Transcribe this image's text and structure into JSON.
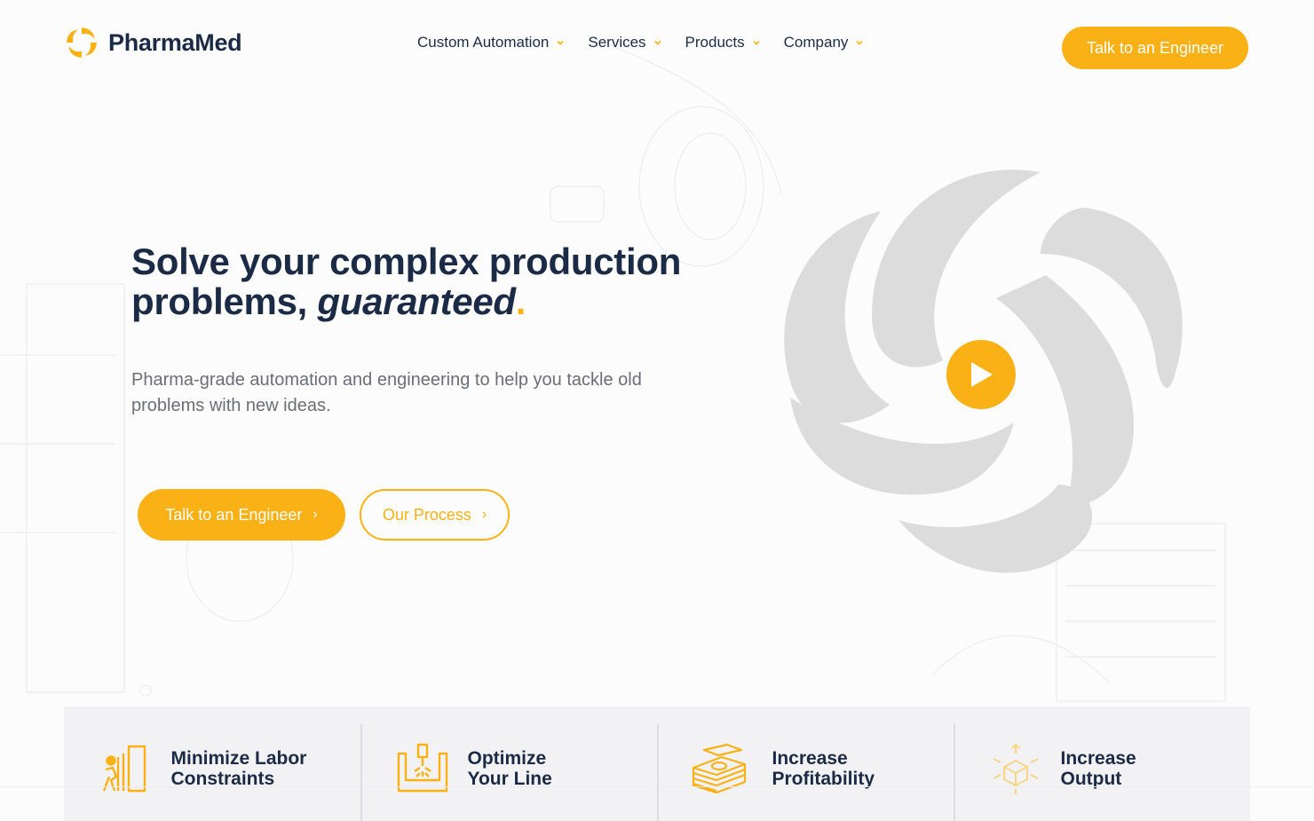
{
  "brand": {
    "name": "PharmaMed",
    "accent": "#fab115",
    "dark": "#1c2b45",
    "swirl": "#dcdcdc"
  },
  "nav": {
    "items": [
      {
        "label": "Custom Automation"
      },
      {
        "label": "Services"
      },
      {
        "label": "Products"
      },
      {
        "label": "Company"
      }
    ],
    "cta": "Talk to an Engineer"
  },
  "hero": {
    "title_line1": "Solve your complex production",
    "title_line2_prefix": "problems, ",
    "title_emphasis": "guaranteed",
    "title_dot": ".",
    "subtitle": "Pharma-grade automation and engineering to help you tackle old problems with new ideas.",
    "primary_cta": "Talk to an Engineer",
    "secondary_cta": "Our Process",
    "arrow_glyph": "›"
  },
  "benefits": [
    {
      "icon": "labor-worker-icon",
      "line1": "Minimize Labor",
      "line2": "Constraints"
    },
    {
      "icon": "production-line-icon",
      "line1": "Optimize",
      "line2": "Your Line"
    },
    {
      "icon": "money-stack-icon",
      "line1": "Increase",
      "line2": "Profitability"
    },
    {
      "icon": "output-cube-icon",
      "line1": "Increase",
      "line2": "Output"
    }
  ]
}
